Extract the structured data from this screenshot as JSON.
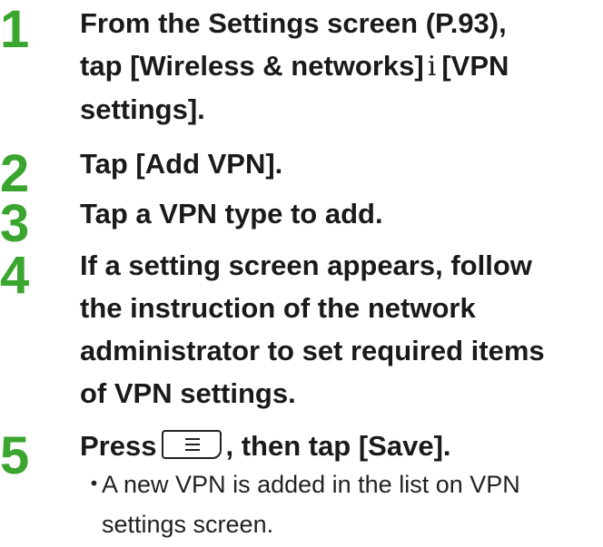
{
  "accent_color": "#3aa52f",
  "steps": [
    {
      "number": "1",
      "line_a": "From the Settings screen (P.93),",
      "line_b_pre": "tap [Wireless & networks]",
      "arrow": "i",
      "line_b_post": "[VPN",
      "line_c": "settings]."
    },
    {
      "number": "2",
      "text": "Tap [Add VPN]."
    },
    {
      "number": "3",
      "text": "Tap a VPN type to add."
    },
    {
      "number": "4",
      "lines": [
        "If a setting screen appears, follow",
        "the instruction of the network",
        "administrator to set required items",
        "of VPN settings."
      ]
    },
    {
      "number": "5",
      "text_pre": "Press",
      "key_icon": "menu-key-icon",
      "text_post": ", then tap [Save].",
      "note_bullet": "・",
      "note_lines": [
        "A new VPN is added in the list on VPN",
        "settings screen."
      ]
    }
  ]
}
